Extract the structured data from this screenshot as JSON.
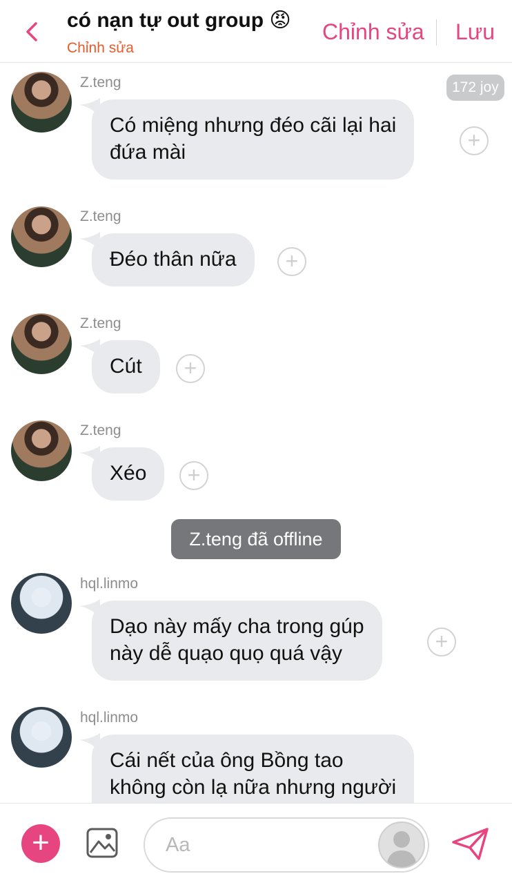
{
  "header": {
    "back_icon": "chevron-left-icon",
    "title": "có nạn tự out group 😡",
    "subtitle": "Chỉnh sửa",
    "edit_label": "Chỉnh sửa",
    "save_label": "Lưu",
    "accent_color": "#e6457f"
  },
  "joy_badge": "172 joy",
  "messages": [
    {
      "sender": "Z.teng",
      "lines": [
        "Có miệng nhưng đéo cãi lại hai",
        "đứa mài"
      ]
    },
    {
      "sender": "Z.teng",
      "lines": [
        "Đéo thân nữa"
      ]
    },
    {
      "sender": "Z.teng",
      "lines": [
        "Cút"
      ]
    },
    {
      "sender": "Z.teng",
      "lines": [
        "Xéo"
      ]
    },
    {
      "sender": "hql.linmo",
      "lines": [
        "Dạo này mấy cha trong gúp",
        "này dễ quạo quọ quá vậy"
      ]
    },
    {
      "sender": "hql.linmo",
      "lines": [
        "Cái nết của ông Bồng tao",
        "không còn lạ nữa nhưng người"
      ]
    }
  ],
  "status_text": "Z.teng đã offline",
  "composer": {
    "add_icon": "plus-icon",
    "image_icon": "image-icon",
    "placeholder": "Aa",
    "send_icon": "send-icon"
  }
}
